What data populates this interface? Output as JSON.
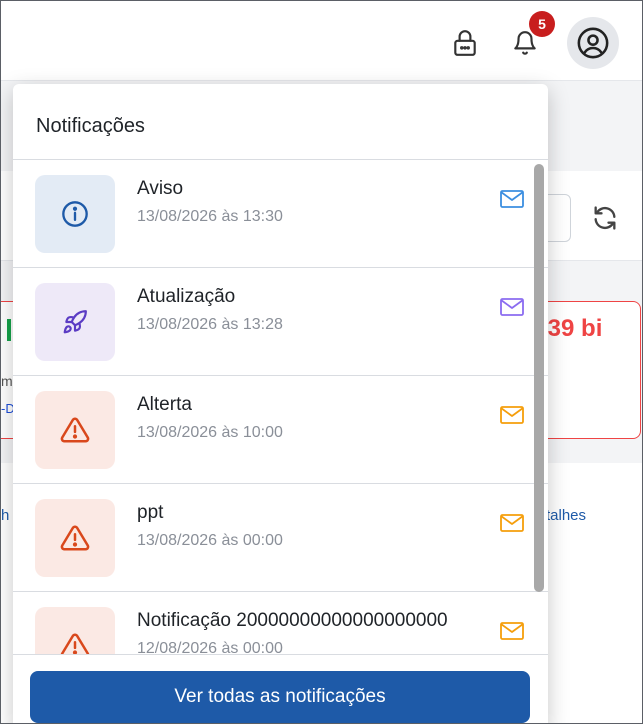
{
  "header": {
    "notification_count": "5",
    "icons": [
      "lock-icon",
      "bell-icon",
      "user-circle-icon"
    ]
  },
  "background": {
    "value_text": ",39 bi",
    "partial_m": "m",
    "partial_d": "-D",
    "partial_h": "h",
    "link_text": "talhes"
  },
  "notifications": {
    "title": "Notificações",
    "items": [
      {
        "title": "Aviso",
        "date": "13/08/2026 às 13:30",
        "icon": "info-icon",
        "icon_color": "#1e5aa8",
        "box_color": "#e3ebf5",
        "mail_color": "#3b8ee0"
      },
      {
        "title": "Atualização",
        "date": "13/08/2026 às 13:28",
        "icon": "rocket-icon",
        "icon_color": "#5b3cc4",
        "box_color": "#eee9f8",
        "mail_color": "#8b6cf0"
      },
      {
        "title": "Alterta",
        "date": "13/08/2026 às 10:00",
        "icon": "warning-icon",
        "icon_color": "#d9481c",
        "box_color": "#fbe9e4",
        "mail_color": "#f59e0b"
      },
      {
        "title": "ppt",
        "date": "13/08/2026 às 00:00",
        "icon": "warning-icon",
        "icon_color": "#d9481c",
        "box_color": "#fbe9e4",
        "mail_color": "#f59e0b"
      },
      {
        "title": "Notificação 20000000000000000000",
        "date": "12/08/2026 às 00:00",
        "icon": "warning-icon",
        "icon_color": "#d9481c",
        "box_color": "#fbe9e4",
        "mail_color": "#f59e0b"
      }
    ],
    "view_all_label": "Ver todas as notificações"
  },
  "colors": {
    "primary": "#1e5aa8",
    "badge": "#c81e1e",
    "danger": "#ef4444"
  }
}
